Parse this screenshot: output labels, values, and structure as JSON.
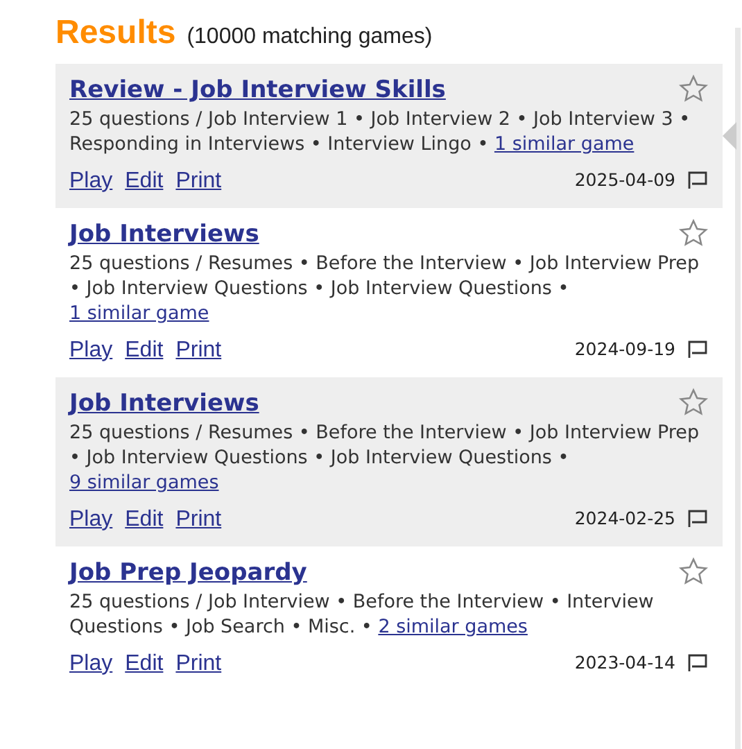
{
  "heading": {
    "title": "Results",
    "count": "(10000 matching games)"
  },
  "games": [
    {
      "title": "Review - Job Interview Skills",
      "description": "25 questions / Job Interview 1 • Job Interview 2 • Job Interview 3 • Responding in Interviews • Interview Lingo •",
      "similar": "1 similar game",
      "actions": [
        "Play",
        "Edit",
        "Print"
      ],
      "date": "2025-04-09",
      "selected": true
    },
    {
      "title": "Job Interviews",
      "description": "25 questions / Resumes • Before the Interview • Job Interview Prep • Job Interview Questions • Job Interview Questions •",
      "similar": "1 similar game",
      "actions": [
        "Play",
        "Edit",
        "Print"
      ],
      "date": "2024-09-19",
      "selected": false
    },
    {
      "title": "Job Interviews",
      "description": "25 questions / Resumes • Before the Interview • Job Interview Prep • Job Interview Questions • Job Interview Questions •",
      "similar": "9 similar games",
      "actions": [
        "Play",
        "Edit",
        "Print"
      ],
      "date": "2024-02-25",
      "selected": false
    },
    {
      "title": "Job Prep Jeopardy",
      "description": "25 questions / Job Interview • Before the Interview • Interview Questions • Job Search • Misc. •",
      "similar": "2 similar games",
      "actions": [
        "Play",
        "Edit",
        "Print"
      ],
      "date": "2023-04-14",
      "selected": false
    }
  ]
}
